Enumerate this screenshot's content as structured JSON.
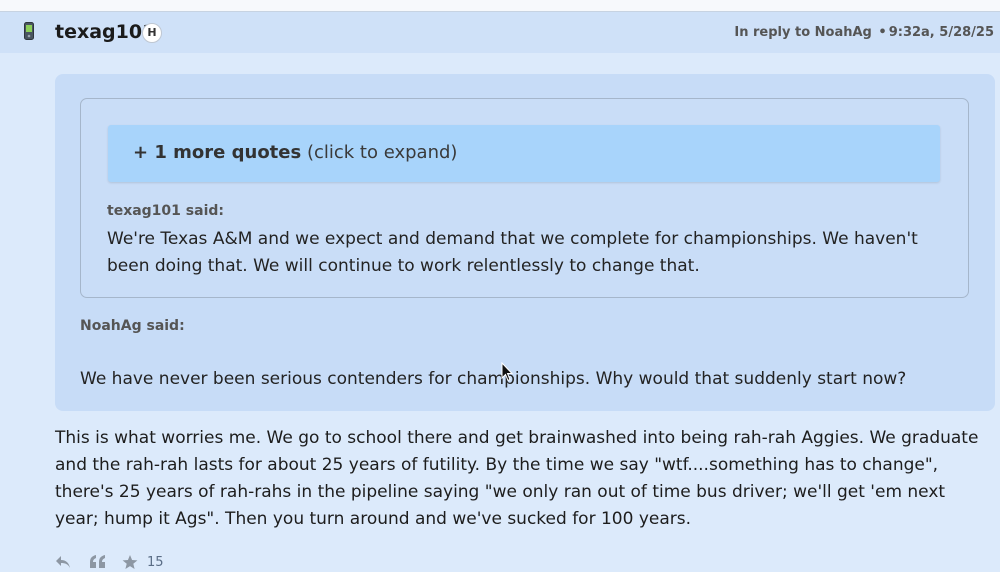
{
  "post": {
    "username": "texag101",
    "badge": "H",
    "reply_to": "In reply to NoahAg",
    "separator": "•",
    "timestamp": "9:32a, 5/28/25",
    "device_icon": "phone-icon"
  },
  "quotes": {
    "expand_count": "+ 1 more quotes",
    "expand_hint": "(click to expand)",
    "inner": {
      "author_label": "texag101 said:",
      "text": "We're Texas A&M and we expect and demand that we complete for championships. We haven't been doing that. We will continue to work relentlessly to change that."
    },
    "outer": {
      "author_label": "NoahAg said:",
      "text": "We have never been serious contenders for championships. Why would that suddenly start now?"
    }
  },
  "body": {
    "text": "This is what worries me. We go to school there and get brainwashed into being rah-rah Aggies. We graduate and the rah-rah lasts for about 25 years of futility. By the time we say \"wtf....something has to change\", there's 25 years of rah-rahs in the pipeline saying \"we only ran out of time bus driver; we'll get 'em next year; hump it Ags\". Then you turn around and we've sucked for 100 years."
  },
  "actions": {
    "icons": [
      "reply-icon",
      "quote-icon",
      "star-icon"
    ],
    "count": "15"
  },
  "colors": {
    "page_bg": "#dceafb",
    "header_bg": "#cfe1f8",
    "quote_bg": "#c7dcf7",
    "expand_bg": "#a8d4fb"
  }
}
